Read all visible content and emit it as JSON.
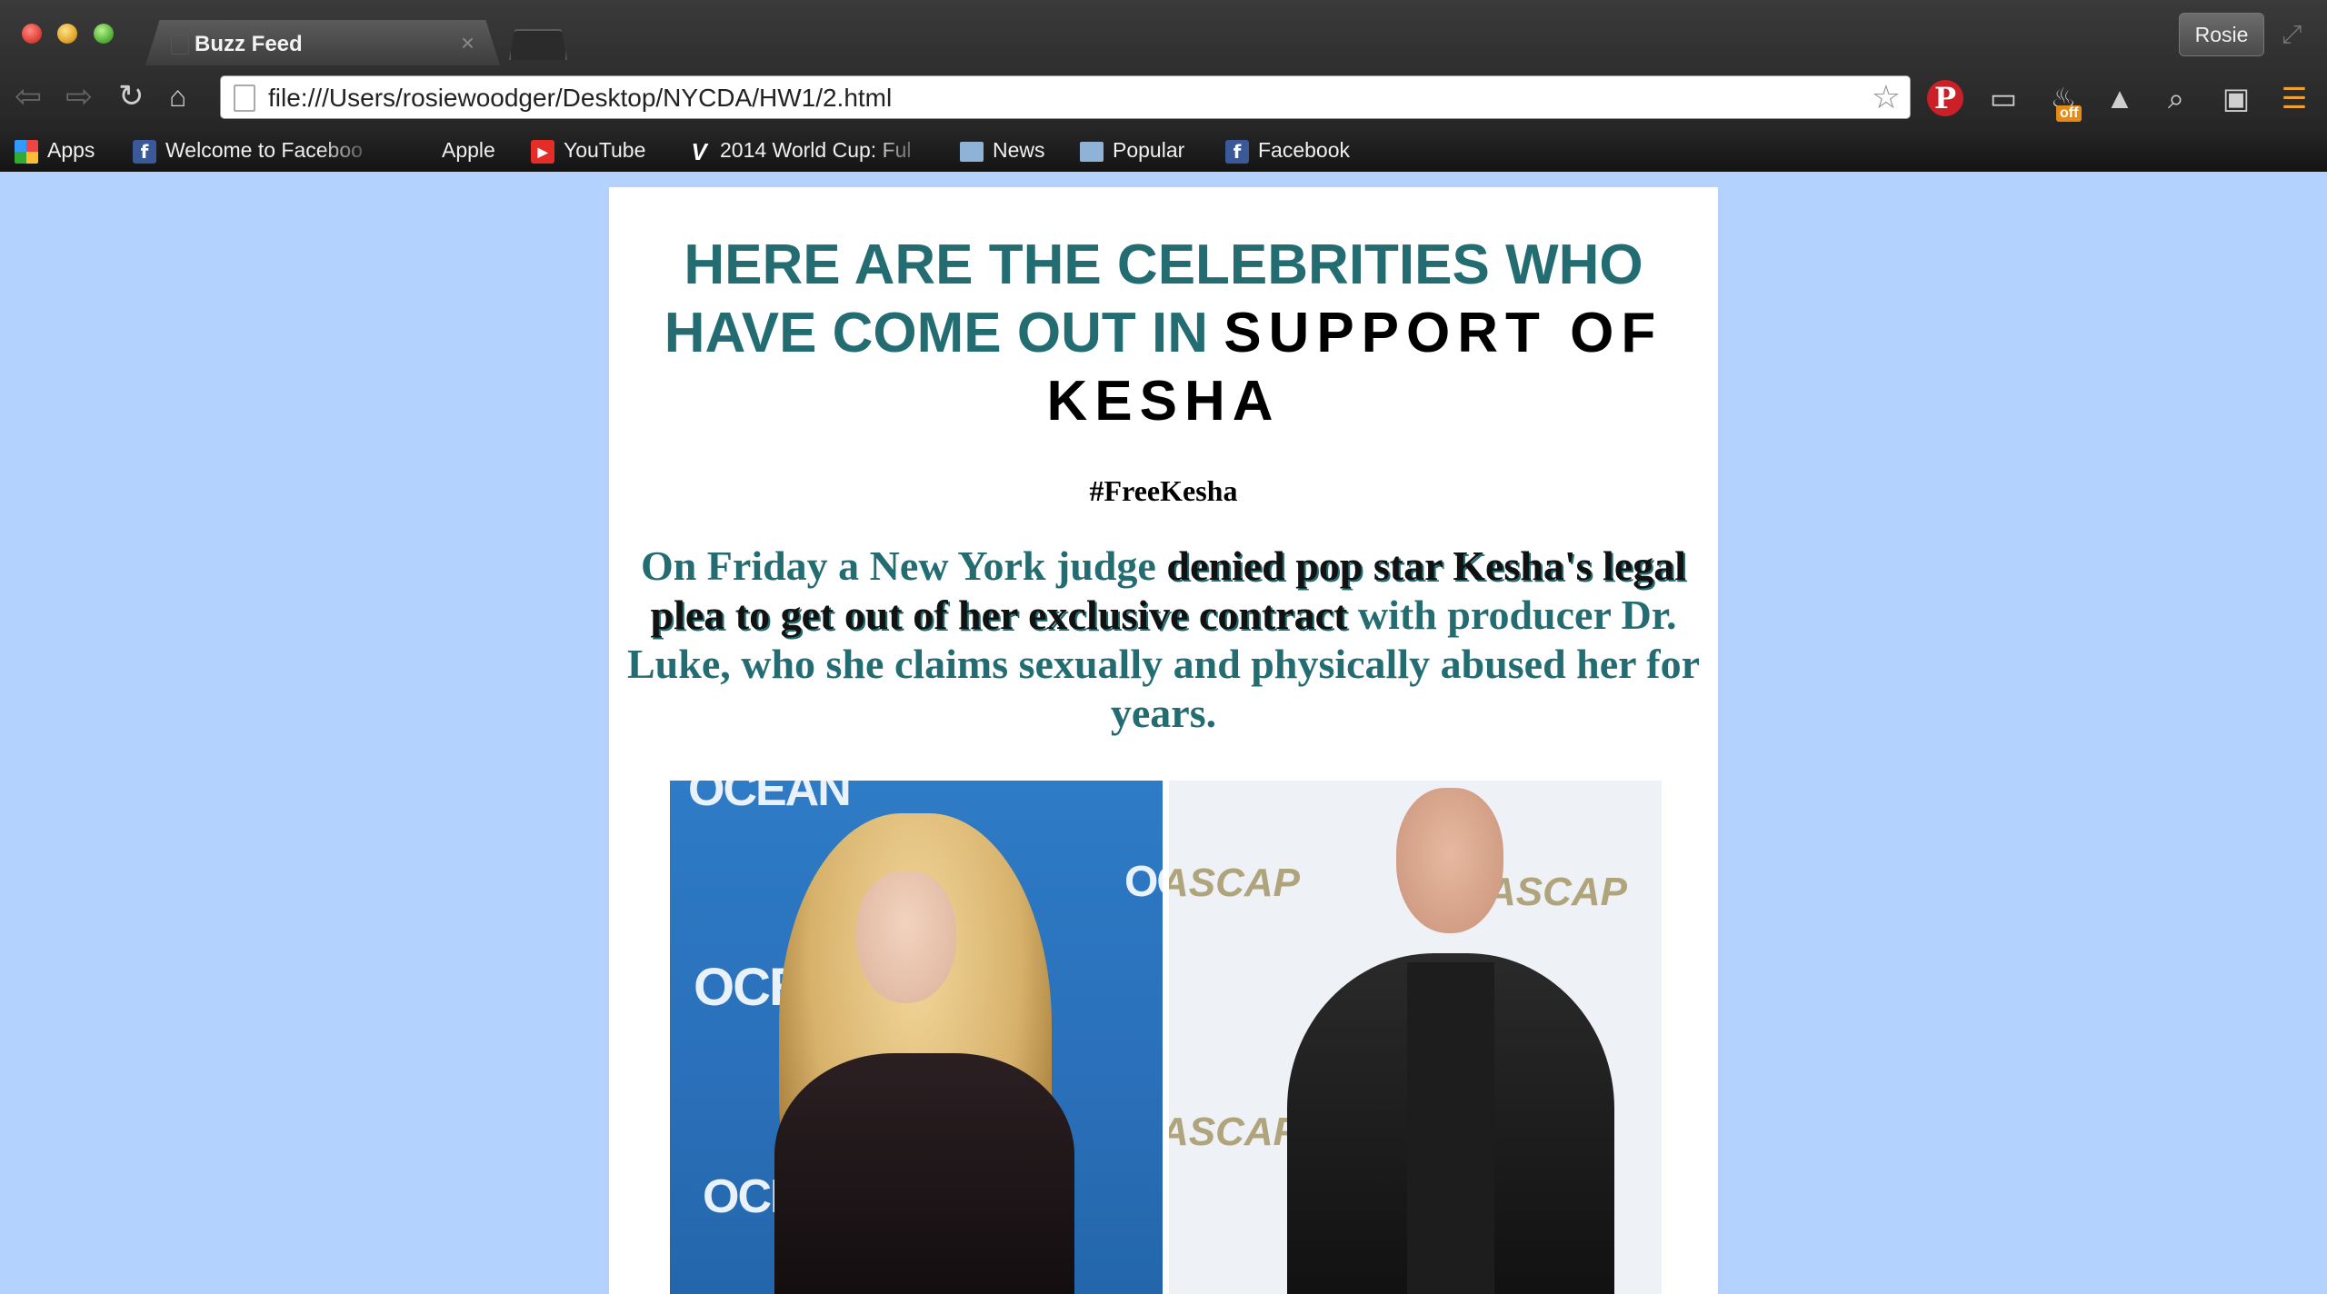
{
  "browser": {
    "tab_title": "Buzz Feed",
    "tab_close": "×",
    "profile_name": "Rosie",
    "url": "file:///Users/rosiewoodger/Desktop/NYCDA/HW1/2.html",
    "extension_badge": "off",
    "bookmarks": [
      {
        "label": "Apps",
        "icon": "apps-grid-icon"
      },
      {
        "label": "Welcome to Faceboo",
        "icon": "facebook-icon"
      },
      {
        "label": "Apple",
        "icon": "apple-icon"
      },
      {
        "label": "YouTube",
        "icon": "youtube-icon"
      },
      {
        "label": "2014 World Cup: Ful",
        "icon": "worldcup-icon"
      },
      {
        "label": "News",
        "icon": "folder-icon"
      },
      {
        "label": "Popular",
        "icon": "folder-icon"
      },
      {
        "label": "Facebook",
        "icon": "facebook-icon"
      }
    ]
  },
  "article": {
    "headline_part1": "HERE ARE THE CELEBRITIES WHO HAVE COME OUT IN",
    "headline_part2": "SUPPORT OF KESHA",
    "hashtag": "#FreeKesha",
    "lede_part1": "On Friday a New York judge",
    "lede_emphasis": "denied pop star Kesha's legal plea to get out of her exclusive contract",
    "lede_part2": "with producer Dr. Luke, who she claims sexually and physically abused her for years.",
    "photo_left_watermark": "OCEAN",
    "photo_right_watermark": "ASCAP"
  },
  "colors": {
    "page_background": "#b4d2fe",
    "headline_teal": "#236c71",
    "card": "#ffffff"
  }
}
